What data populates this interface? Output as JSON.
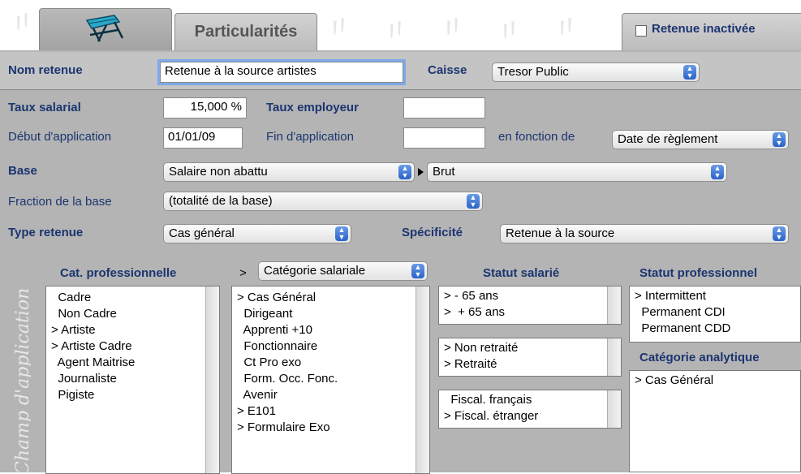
{
  "tabs": {
    "first_icon": "deck-chair-icon",
    "second_label": "Particularités"
  },
  "retenue_inactivee": {
    "label": "Retenue inactivée",
    "checked": false
  },
  "form": {
    "nom_retenue_label": "Nom retenue",
    "nom_retenue_value": "Retenue à la source artistes",
    "caisse_label": "Caisse",
    "caisse_value": "Tresor Public",
    "taux_salarial_label": "Taux salarial",
    "taux_salarial_value": "15,000 %",
    "taux_employeur_label": "Taux employeur",
    "taux_employeur_value": "",
    "debut_label": "Début d'application",
    "debut_value": "01/01/09",
    "fin_label": "Fin d'application",
    "fin_value": "",
    "en_fonction_label": "en fonction de",
    "en_fonction_value": "Date de règlement",
    "base_label": "Base",
    "base_value": "Salaire non abattu",
    "base_value2": "Brut",
    "fraction_label": "Fraction de la base",
    "fraction_value": "(totalité de la base)",
    "type_label": "Type retenue",
    "type_value": "Cas général",
    "specificite_label": "Spécificité",
    "specificite_value": "Retenue à la source"
  },
  "champ": {
    "side_label": "Champ d'application",
    "cat_pro_header": "Cat. professionnelle",
    "cat_pro_items": [
      "  Cadre",
      "  Non Cadre",
      "> Artiste",
      "> Artiste Cadre",
      "  Agent Maitrise",
      "  Journaliste",
      "  Pigiste"
    ],
    "gt": ">",
    "cat_sal_popup": "Catégorie salariale",
    "cat_sal_items": [
      "> Cas Général",
      "  Dirigeant",
      "  Apprenti +10",
      "  Fonctionnaire",
      "  Ct Pro exo",
      "  Form. Occ. Fonc.",
      "  Avenir",
      "> E101",
      "> Formulaire Exo"
    ],
    "statut_sal_header": "Statut salarié",
    "age_items": [
      "> - 65 ans",
      ">  + 65 ans"
    ],
    "retraite_items": [
      "> Non retraité",
      "> Retraité"
    ],
    "fiscal_items": [
      "  Fiscal. français",
      "> Fiscal. étranger"
    ],
    "statut_pro_header": "Statut professionnel",
    "statut_pro_items": [
      "> Intermittent",
      "  Permanent CDI",
      "  Permanent CDD"
    ],
    "cat_ana_header": "Catégorie analytique",
    "cat_ana_items": [
      "> Cas Général"
    ]
  },
  "colors": {
    "label_blue": "#1b3570",
    "panel_grey": "#b4b4b4",
    "popup_arrow_blue": "#2a63c8"
  }
}
